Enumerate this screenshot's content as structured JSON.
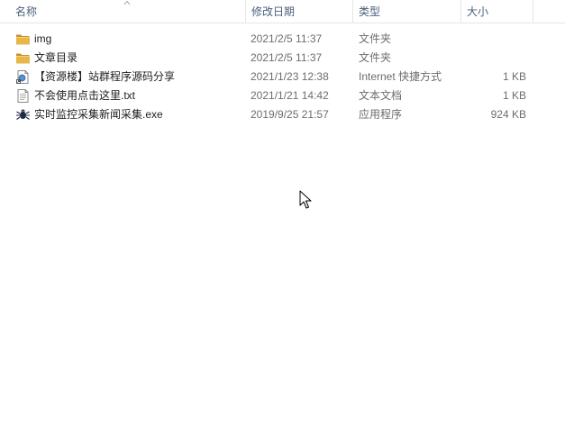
{
  "header": {
    "name_label": "名称",
    "date_label": "修改日期",
    "type_label": "类型",
    "size_label": "大小"
  },
  "files": [
    {
      "name": "img",
      "date": "2021/2/5 11:37",
      "type": "文件夹",
      "size": "",
      "icon": "folder-icon"
    },
    {
      "name": "文章目录",
      "date": "2021/2/5 11:37",
      "type": "文件夹",
      "size": "",
      "icon": "folder-icon"
    },
    {
      "name": "【资源楼】站群程序源码分享",
      "date": "2021/1/23 12:38",
      "type": "Internet 快捷方式",
      "size": "1 KB",
      "icon": "internet-shortcut-icon"
    },
    {
      "name": "不会使用点击这里.txt",
      "date": "2021/1/21 14:42",
      "type": "文本文档",
      "size": "1 KB",
      "icon": "text-document-icon"
    },
    {
      "name": "实时监控采集新闻采集.exe",
      "date": "2019/9/25 21:57",
      "type": "应用程序",
      "size": "924 KB",
      "icon": "application-icon"
    }
  ],
  "colors": {
    "header_text": "#4c607a",
    "folder": "#e8b74a",
    "folder_dark": "#c8922a"
  }
}
